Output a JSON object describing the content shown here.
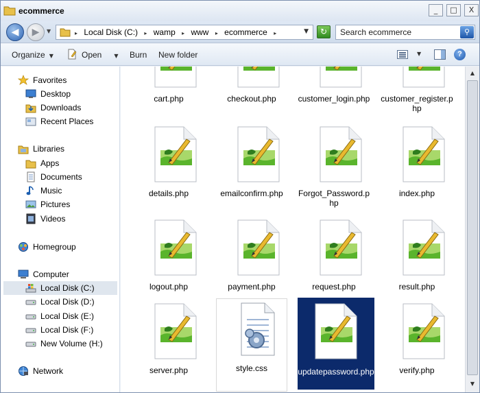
{
  "window": {
    "title": "ecommerce"
  },
  "title_buttons": {
    "minimize": "_",
    "maximize": "□",
    "close": "X"
  },
  "address": {
    "crumbs": [
      "Local Disk (C:)",
      "wamp",
      "www",
      "ecommerce"
    ],
    "search_placeholder": "Search ecommerce"
  },
  "toolbar": {
    "organize": "Organize",
    "open": "Open",
    "burn": "Burn",
    "new_folder": "New folder",
    "help": "?"
  },
  "nav": {
    "favorites_header": "Favorites",
    "favorites": [
      "Desktop",
      "Downloads",
      "Recent Places"
    ],
    "libraries_header": "Libraries",
    "libraries": [
      "Apps",
      "Documents",
      "Music",
      "Pictures",
      "Videos"
    ],
    "homegroup": "Homegroup",
    "computer_header": "Computer",
    "drives": [
      "Local Disk (C:)",
      "Local Disk (D:)",
      "Local Disk (E:)",
      "Local Disk (F:)",
      "New Volume (H:)"
    ],
    "network": "Network"
  },
  "files": [
    {
      "name": "cart.php",
      "type": "php",
      "selected": false
    },
    {
      "name": "checkout.php",
      "type": "php",
      "selected": false
    },
    {
      "name": "customer_login.php",
      "type": "php",
      "selected": false
    },
    {
      "name": "customer_register.php",
      "type": "php",
      "selected": false
    },
    {
      "name": "details.php",
      "type": "php",
      "selected": false
    },
    {
      "name": "emailconfirm.php",
      "type": "php",
      "selected": false
    },
    {
      "name": "Forgot_Password.php",
      "type": "php",
      "selected": false
    },
    {
      "name": "index.php",
      "type": "php",
      "selected": false
    },
    {
      "name": "logout.php",
      "type": "php",
      "selected": false
    },
    {
      "name": "payment.php",
      "type": "php",
      "selected": false
    },
    {
      "name": "request.php",
      "type": "php",
      "selected": false
    },
    {
      "name": "result.php",
      "type": "php",
      "selected": false
    },
    {
      "name": "server.php",
      "type": "php",
      "selected": false
    },
    {
      "name": "style.css",
      "type": "css",
      "selected": false
    },
    {
      "name": "updatepassword.php",
      "type": "php",
      "selected": true
    },
    {
      "name": "verify.php",
      "type": "php",
      "selected": false
    }
  ],
  "colors": {
    "selection": "#0c2a6b",
    "window_frame": "#dde6f2"
  }
}
